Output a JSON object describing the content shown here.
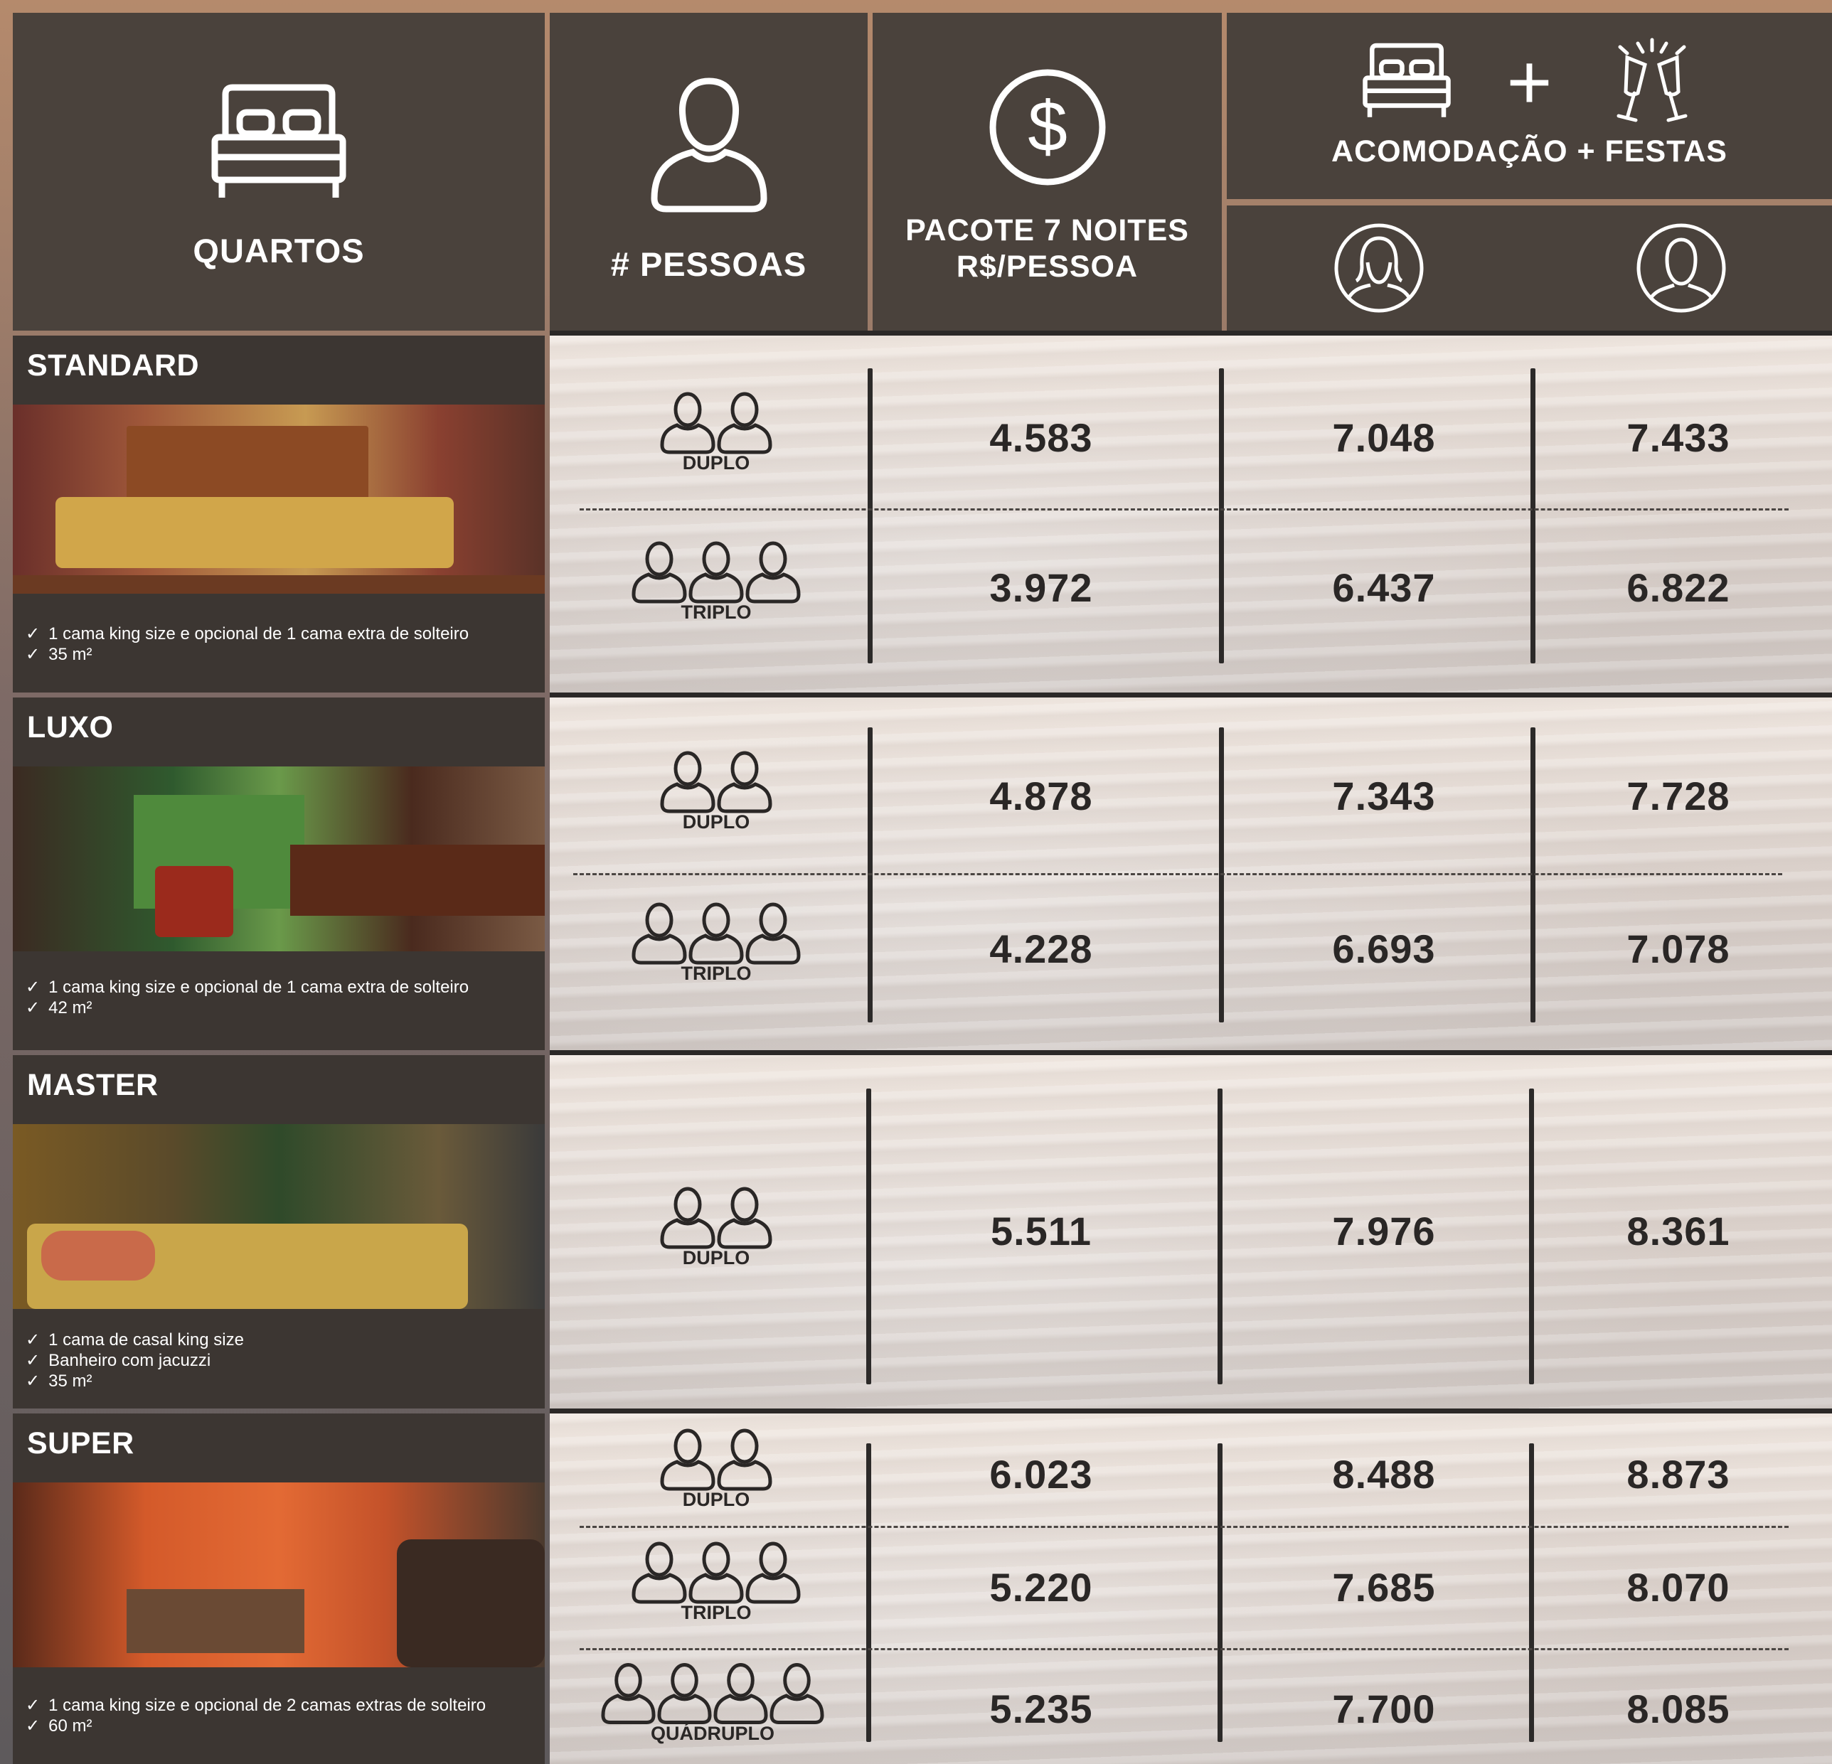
{
  "header": {
    "quartos_label": "QUARTOS",
    "pessoas_label": "# PESSOAS",
    "pacote_line1": "PACOTE 7 NOITES",
    "pacote_line2": "R$/PESSOA",
    "acomodacao_label": "ACOMODAÇÃO + FESTAS",
    "plus_sign": "+"
  },
  "occupancy_labels": {
    "duplo": "DUPLO",
    "triplo": "TRIPLO",
    "quadruplo": "QUÁDRUPLO"
  },
  "rooms": [
    {
      "name": "STANDARD",
      "features": [
        "1 cama king size e opcional de 1 cama extra de solteiro",
        "35 m²"
      ],
      "rows": [
        {
          "occupancy": "DUPLO",
          "pacote": "4.583",
          "female": "7.048",
          "male": "7.433"
        },
        {
          "occupancy": "TRIPLO",
          "pacote": "3.972",
          "female": "6.437",
          "male": "6.822"
        }
      ]
    },
    {
      "name": "LUXO",
      "features": [
        "1 cama king size e opcional de 1 cama extra de solteiro",
        "42 m²"
      ],
      "rows": [
        {
          "occupancy": "DUPLO",
          "pacote": "4.878",
          "female": "7.343",
          "male": "7.728"
        },
        {
          "occupancy": "TRIPLO",
          "pacote": "4.228",
          "female": "6.693",
          "male": "7.078"
        }
      ]
    },
    {
      "name": "MASTER",
      "features": [
        "1 cama de casal king size",
        "Banheiro com jacuzzi",
        "35 m²"
      ],
      "rows": [
        {
          "occupancy": "DUPLO",
          "pacote": "5.511",
          "female": "7.976",
          "male": "8.361"
        }
      ]
    },
    {
      "name": "SUPER",
      "features": [
        "1 cama king size e opcional de 2 camas extras de solteiro",
        "60 m²"
      ],
      "rows": [
        {
          "occupancy": "DUPLO",
          "pacote": "6.023",
          "female": "8.488",
          "male": "8.873"
        },
        {
          "occupancy": "TRIPLO",
          "pacote": "5.220",
          "female": "7.685",
          "male": "8.070"
        },
        {
          "occupancy": "QUÁDRUPLO",
          "pacote": "5.235",
          "female": "7.700",
          "male": "8.085"
        }
      ]
    }
  ],
  "icons": {
    "quartos": "bed-icon",
    "pessoas": "person-icon",
    "pacote": "dollar-coin-icon",
    "acomodacao": [
      "bed-icon",
      "plus-icon",
      "champagne-toast-icon"
    ],
    "female": "female-avatar-icon",
    "male": "male-avatar-icon",
    "occupancy": "person-outline-icon"
  },
  "colors": {
    "header_bg": "#4a423c",
    "separator": "#2b2827",
    "text_dark": "#2a2726",
    "text_light": "#ffffff"
  }
}
